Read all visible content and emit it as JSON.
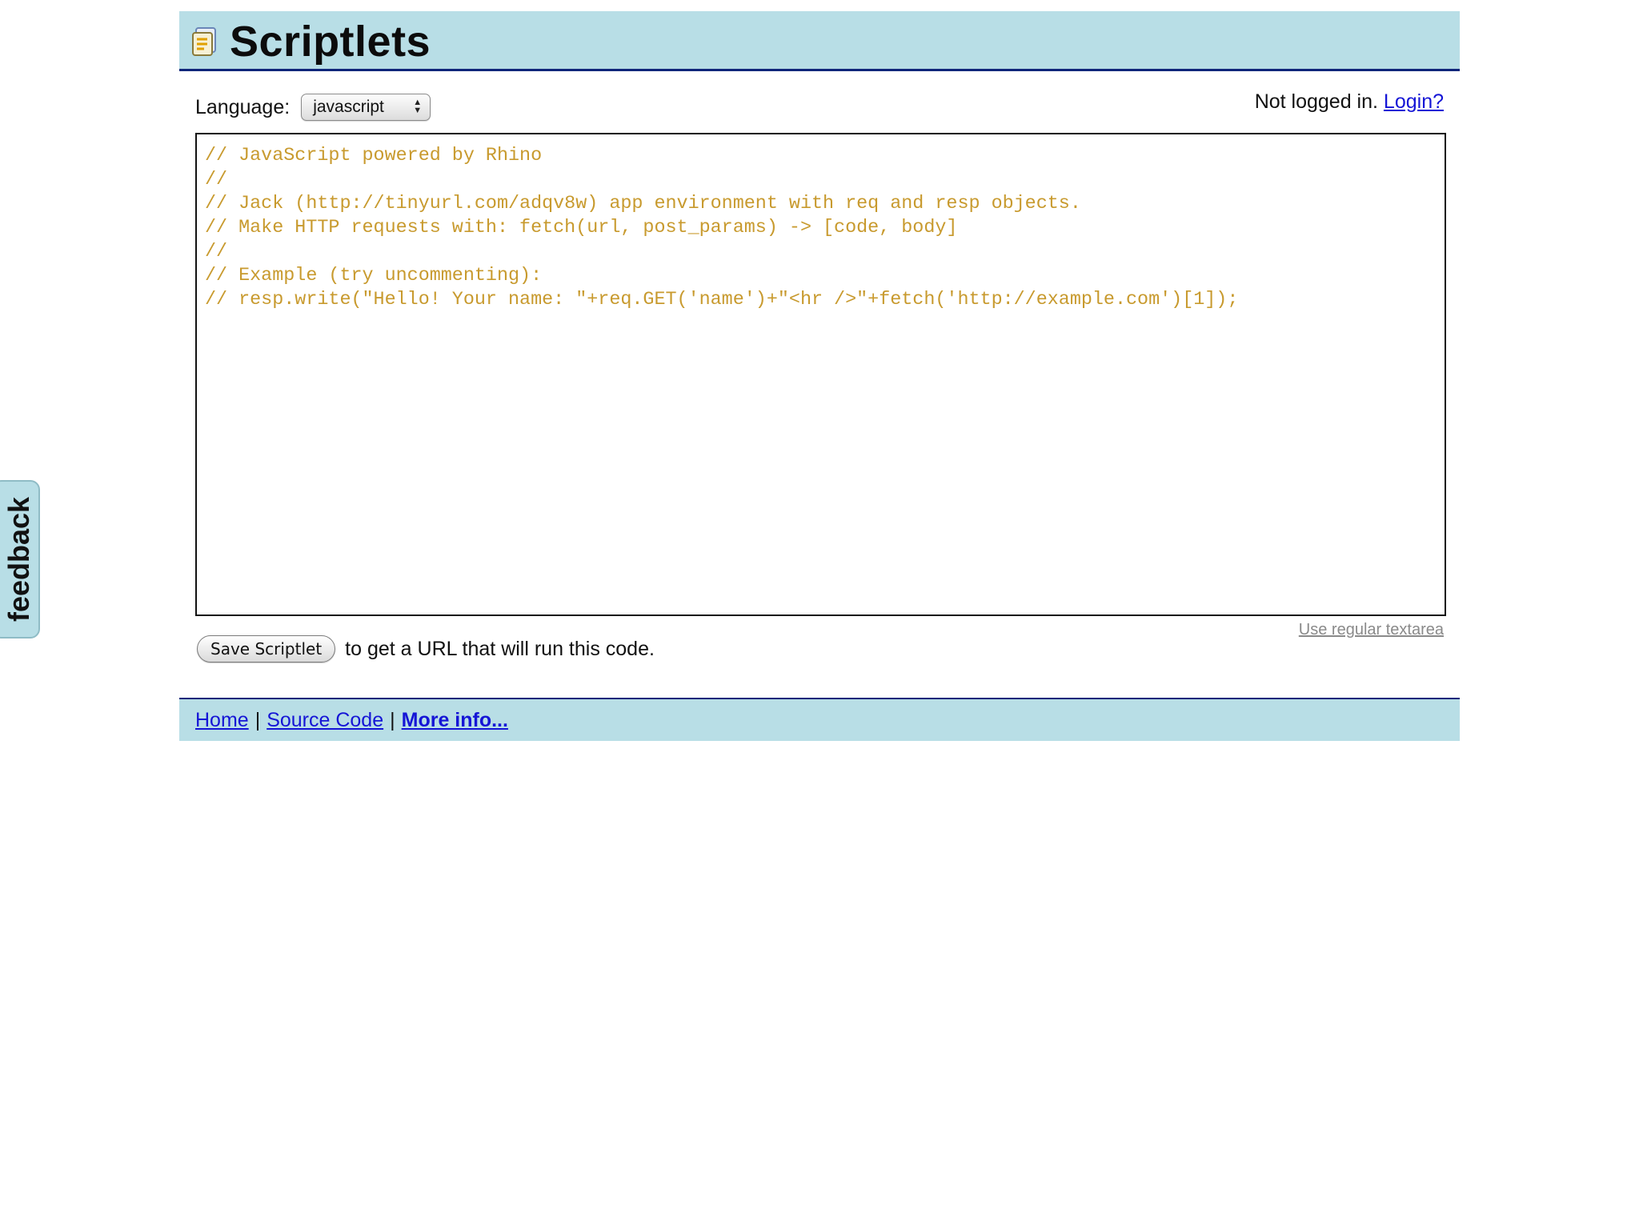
{
  "app": {
    "title": "Scriptlets",
    "logo_icon": "scroll-icon"
  },
  "toolbar": {
    "language_label": "Language:",
    "language_value": "javascript",
    "status_text": "Not logged in.",
    "login_link": "Login?"
  },
  "editor": {
    "code": "// JavaScript powered by Rhino\n//\n// Jack (http://tinyurl.com/adqv8w) app environment with req and resp objects.\n// Make HTTP requests with: fetch(url, post_params) -> [code, body]\n//\n// Example (try uncommenting):\n// resp.write(\"Hello! Your name: \"+req.GET('name')+\"<hr />\"+fetch('http://example.com')[1]);",
    "use_textarea_link": "Use regular textarea"
  },
  "actions": {
    "save_label": "Save Scriptlet",
    "save_hint": "to get a URL that will run this code."
  },
  "footer": {
    "links": [
      "Home",
      "Source Code",
      "More info..."
    ],
    "separator": "|"
  },
  "feedback": {
    "label": "feedback"
  },
  "colors": {
    "header_bg": "#b8dee6",
    "header_border": "#10267a",
    "code_comment": "#c89a2e",
    "link": "#1515d6"
  }
}
